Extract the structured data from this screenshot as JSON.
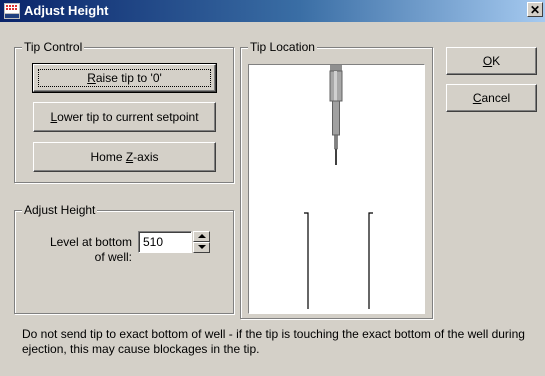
{
  "window": {
    "title": "Adjust Height",
    "close_glyph": "✕",
    "app_icon": "grid-app-icon"
  },
  "tip_control": {
    "label": "Tip Control",
    "raise_button": {
      "prefix": "",
      "mnemonic": "R",
      "suffix": "aise tip to '0'"
    },
    "lower_button": {
      "prefix": "",
      "mnemonic": "L",
      "suffix": "ower tip to current setpoint"
    },
    "home_button": {
      "prefix": "Home ",
      "mnemonic": "Z",
      "suffix": "-axis"
    }
  },
  "adjust_height": {
    "label": "Adjust Height",
    "level_label_line1": "Level at bottom",
    "level_label_line2": "of well:",
    "level_value": "510"
  },
  "tip_location": {
    "label": "Tip Location",
    "background": "#ffffff",
    "tip_color": "#808080"
  },
  "dialog_buttons": {
    "ok": {
      "prefix": "",
      "mnemonic": "O",
      "suffix": "K"
    },
    "cancel": {
      "prefix": "",
      "mnemonic": "C",
      "suffix": "ancel"
    }
  },
  "note": "Do not send tip to exact bottom of well - if the tip is touching the exact bottom of the well during ejection, this may cause blockages in the tip.",
  "colors": {
    "title_start": "#0a246a",
    "title_end": "#a6caf0",
    "face": "#d4d0c8"
  }
}
